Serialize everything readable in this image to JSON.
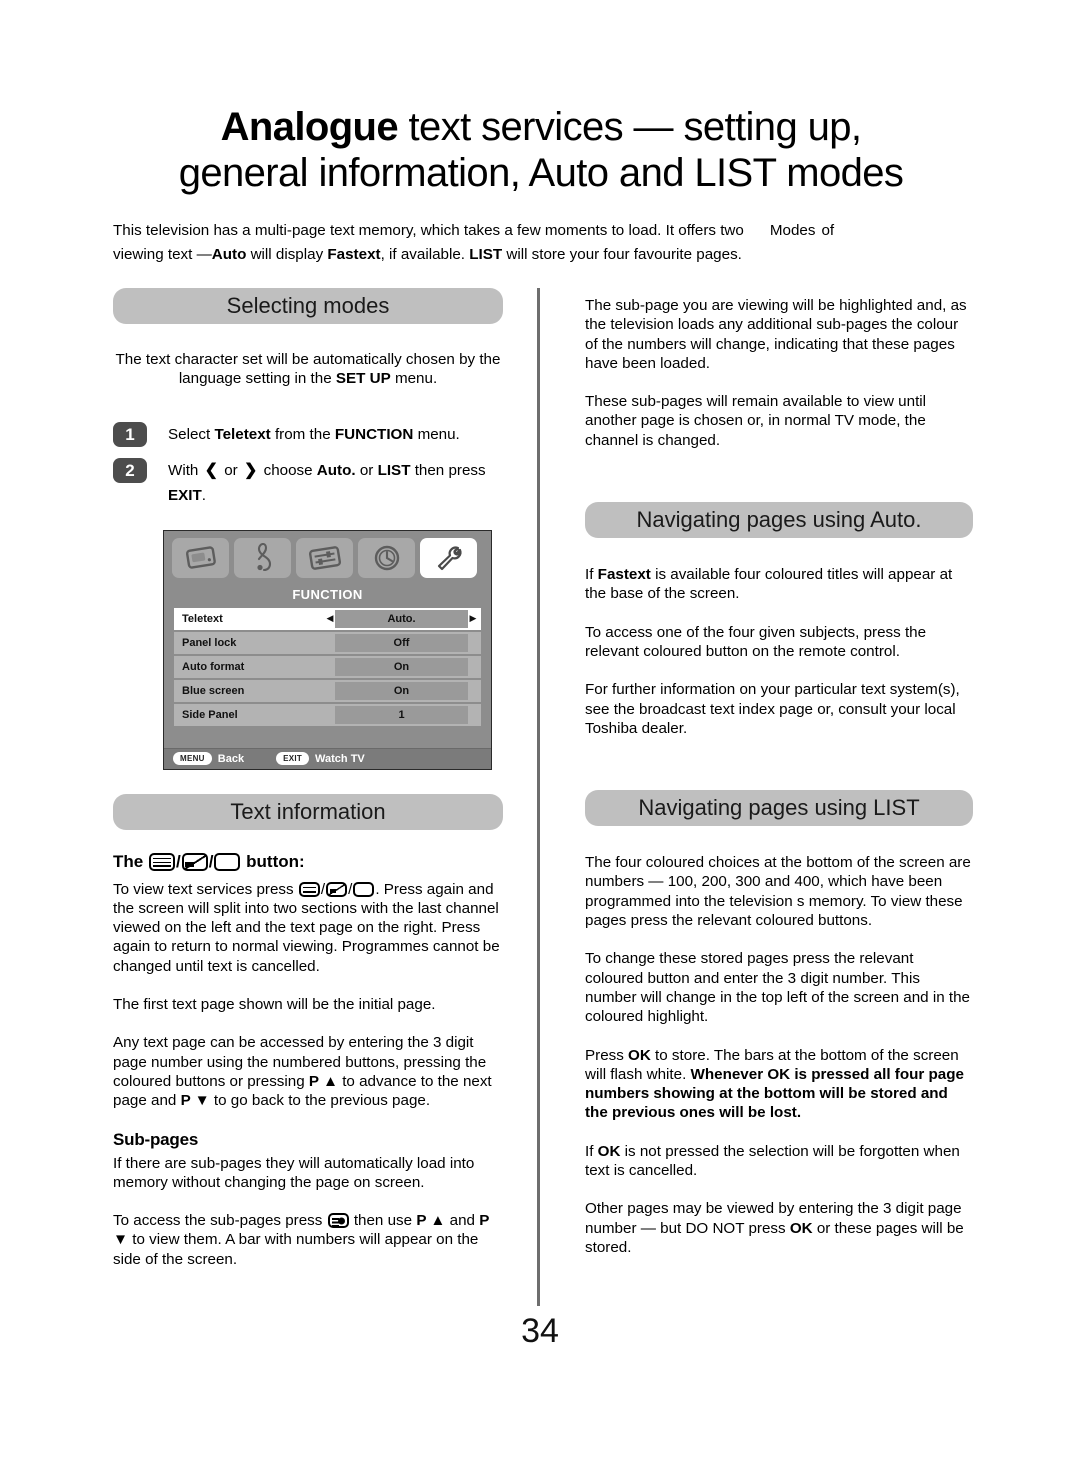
{
  "title": {
    "line1_strong": "Analogue",
    "line1_rest": " text services — setting up,",
    "line2": "general information, Auto and LIST modes"
  },
  "intro": {
    "a": "This television has a multi-page text memory, which takes a few moments to load. It offers two",
    "b": "Modes",
    "c": "of",
    "d": "viewing text —",
    "e": "Auto",
    "f": " will display ",
    "g": "Fastext",
    "h": ", if available. ",
    "i": "LIST",
    "j": " will store your four favourite pages."
  },
  "left": {
    "banner1": "Selecting modes",
    "intro_a": "The text character set will be automatically chosen by the",
    "intro_b": "language setting in the ",
    "intro_setup": "SET UP",
    "intro_c": " menu.",
    "steps": [
      {
        "number": "1",
        "pre": "Select ",
        "bold1": "Teletext",
        "mid": " from the ",
        "bold2": "FUNCTION",
        "post": " menu."
      },
      {
        "number": "2",
        "pre": "With ",
        "arrow_left": "❮",
        "or": " or ",
        "arrow_right": "❯",
        "mid": " choose ",
        "bold1": "Auto.",
        "mid2": " or ",
        "bold2": "LIST",
        "mid3": " then press ",
        "bold3": "EXIT",
        "post": "."
      }
    ],
    "osd": {
      "icons": [
        "picture-screen-icon",
        "treble-clef-audio-icon",
        "sliders-settings-icon",
        "clock-timer-icon",
        "wrench-function-icon"
      ],
      "title": "FUNCTION",
      "rows": [
        {
          "label": "Teletext",
          "value": "Auto.",
          "selected": true
        },
        {
          "label": "Panel lock",
          "value": "Off",
          "selected": false
        },
        {
          "label": "Auto format",
          "value": "On",
          "selected": false
        },
        {
          "label": "Blue screen",
          "value": "On",
          "selected": false
        },
        {
          "label": "Side Panel",
          "value": "1",
          "selected": false
        }
      ],
      "footer": {
        "menu_key": "MENU",
        "menu_label": "Back",
        "exit_key": "EXIT",
        "exit_label": "Watch TV"
      }
    },
    "banner2": "Text information",
    "button_head_pre": "The ",
    "button_head_post": " button:",
    "p1_a": "To view text services press ",
    "p1_b": ". Press again and the screen will split into two sections with the last channel viewed on the left and the text page on the right. Press again to return to normal viewing. Programmes cannot be changed until text is cancelled.",
    "p2": "The first text page shown will be the  initial  page.",
    "p3_a": "Any text page can be accessed by entering the 3 digit page number using the numbered buttons, pressing the coloured buttons or pressing ",
    "p3_p_up": "P ▲",
    "p3_b": " to advance to the next page and ",
    "p3_p_down": "P ▼",
    "p3_c": " to go back to the previous page.",
    "subhead": "Sub-pages",
    "p4": "If there are sub-pages they will automatically load into memory without changing the page on screen.",
    "p5_a": "To access the sub-pages press ",
    "p5_b": " then use ",
    "p5_p_up": "P ▲",
    "p5_c": " and ",
    "p5_p_down": "P ▼",
    "p5_d": " to view them. A bar with numbers will appear on the side of the screen."
  },
  "right": {
    "p1": "The sub-page you are viewing will be highlighted and, as the television loads any additional sub-pages the colour of the numbers will change, indicating that these pages have been loaded.",
    "p2": "These sub-pages will remain available to view until another page is chosen or, in normal TV mode, the channel is changed.",
    "banner1": "Navigating pages using Auto.",
    "p3_a": "If ",
    "p3_fastext": "Fastext",
    "p3_b": " is available four coloured titles will appear at the base of the screen.",
    "p4": "To access one of the four given subjects, press the relevant coloured button on the remote control.",
    "p5": "For further information on your particular text system(s), see the broadcast text index page or, consult your local Toshiba dealer.",
    "banner2": "Navigating pages using LIST",
    "p6": "The four coloured choices at the bottom of the screen are numbers — 100, 200, 300 and 400, which have been programmed into the television s memory. To view these pages press the relevant coloured buttons.",
    "p7": "To change these stored pages press the relevant coloured button and enter the 3 digit number. This number will change in the top left of the screen and in the coloured highlight.",
    "p8_a": "Press ",
    "p8_ok": "OK",
    "p8_b": " to store. The bars at the bottom of the screen will flash white. ",
    "p8_bold": "Whenever OK is pressed all four page numbers showing at the bottom will be stored and the previous ones will be lost.",
    "p9_a": "If ",
    "p9_ok": "OK",
    "p9_b": " is not pressed the selection will be forgotten when text is cancelled.",
    "p10_a": "Other pages may be viewed by entering the 3 digit page number — but DO NOT press ",
    "p10_ok": "OK",
    "p10_b": " or these pages will be stored."
  },
  "page_number": "34",
  "colors": {
    "banner_bg": "#bfbfbf",
    "step_badge_bg": "#4d4d4d",
    "divider": "#6e6e6e",
    "osd_bg": "#8d8d8d",
    "osd_row_bg": "#b3b3b3",
    "osd_row_active_bg": "#ffffff"
  }
}
